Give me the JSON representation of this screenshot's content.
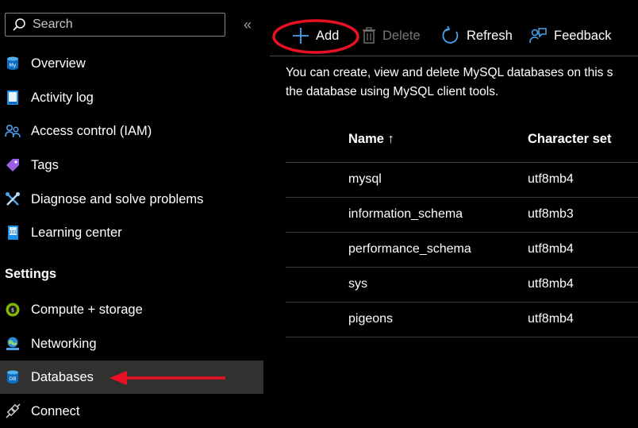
{
  "sidebar": {
    "search": {
      "placeholder": "Search",
      "value": ""
    },
    "collapse_label": "«",
    "items": [
      {
        "label": "Overview",
        "icon": "mysql-server-icon"
      },
      {
        "label": "Activity log",
        "icon": "activity-log-icon"
      },
      {
        "label": "Access control (IAM)",
        "icon": "people-icon"
      },
      {
        "label": "Tags",
        "icon": "tag-icon"
      },
      {
        "label": "Diagnose and solve problems",
        "icon": "wrench-icon"
      },
      {
        "label": "Learning center",
        "icon": "learning-icon"
      }
    ],
    "settings_header": "Settings",
    "settings_items": [
      {
        "label": "Compute + storage",
        "icon": "compute-icon"
      },
      {
        "label": "Networking",
        "icon": "globe-icon"
      },
      {
        "label": "Databases",
        "icon": "database-icon",
        "selected": true
      },
      {
        "label": "Connect",
        "icon": "plug-icon"
      }
    ]
  },
  "toolbar": {
    "add_label": "Add",
    "delete_label": "Delete",
    "refresh_label": "Refresh",
    "feedback_label": "Feedback"
  },
  "main": {
    "description_line1": "You can create, view and delete MySQL databases on this s",
    "description_line2": "the database using MySQL client tools."
  },
  "table": {
    "headers": {
      "name": "Name ↑",
      "charset": "Character set"
    },
    "rows": [
      {
        "name": "mysql",
        "charset": "utf8mb4"
      },
      {
        "name": "information_schema",
        "charset": "utf8mb3"
      },
      {
        "name": "performance_schema",
        "charset": "utf8mb4"
      },
      {
        "name": "sys",
        "charset": "utf8mb4"
      },
      {
        "name": "pigeons",
        "charset": "utf8mb4"
      }
    ]
  },
  "colors": {
    "accent": "#0078d4",
    "annotation": "#e81123",
    "selected_bg": "#323130"
  }
}
